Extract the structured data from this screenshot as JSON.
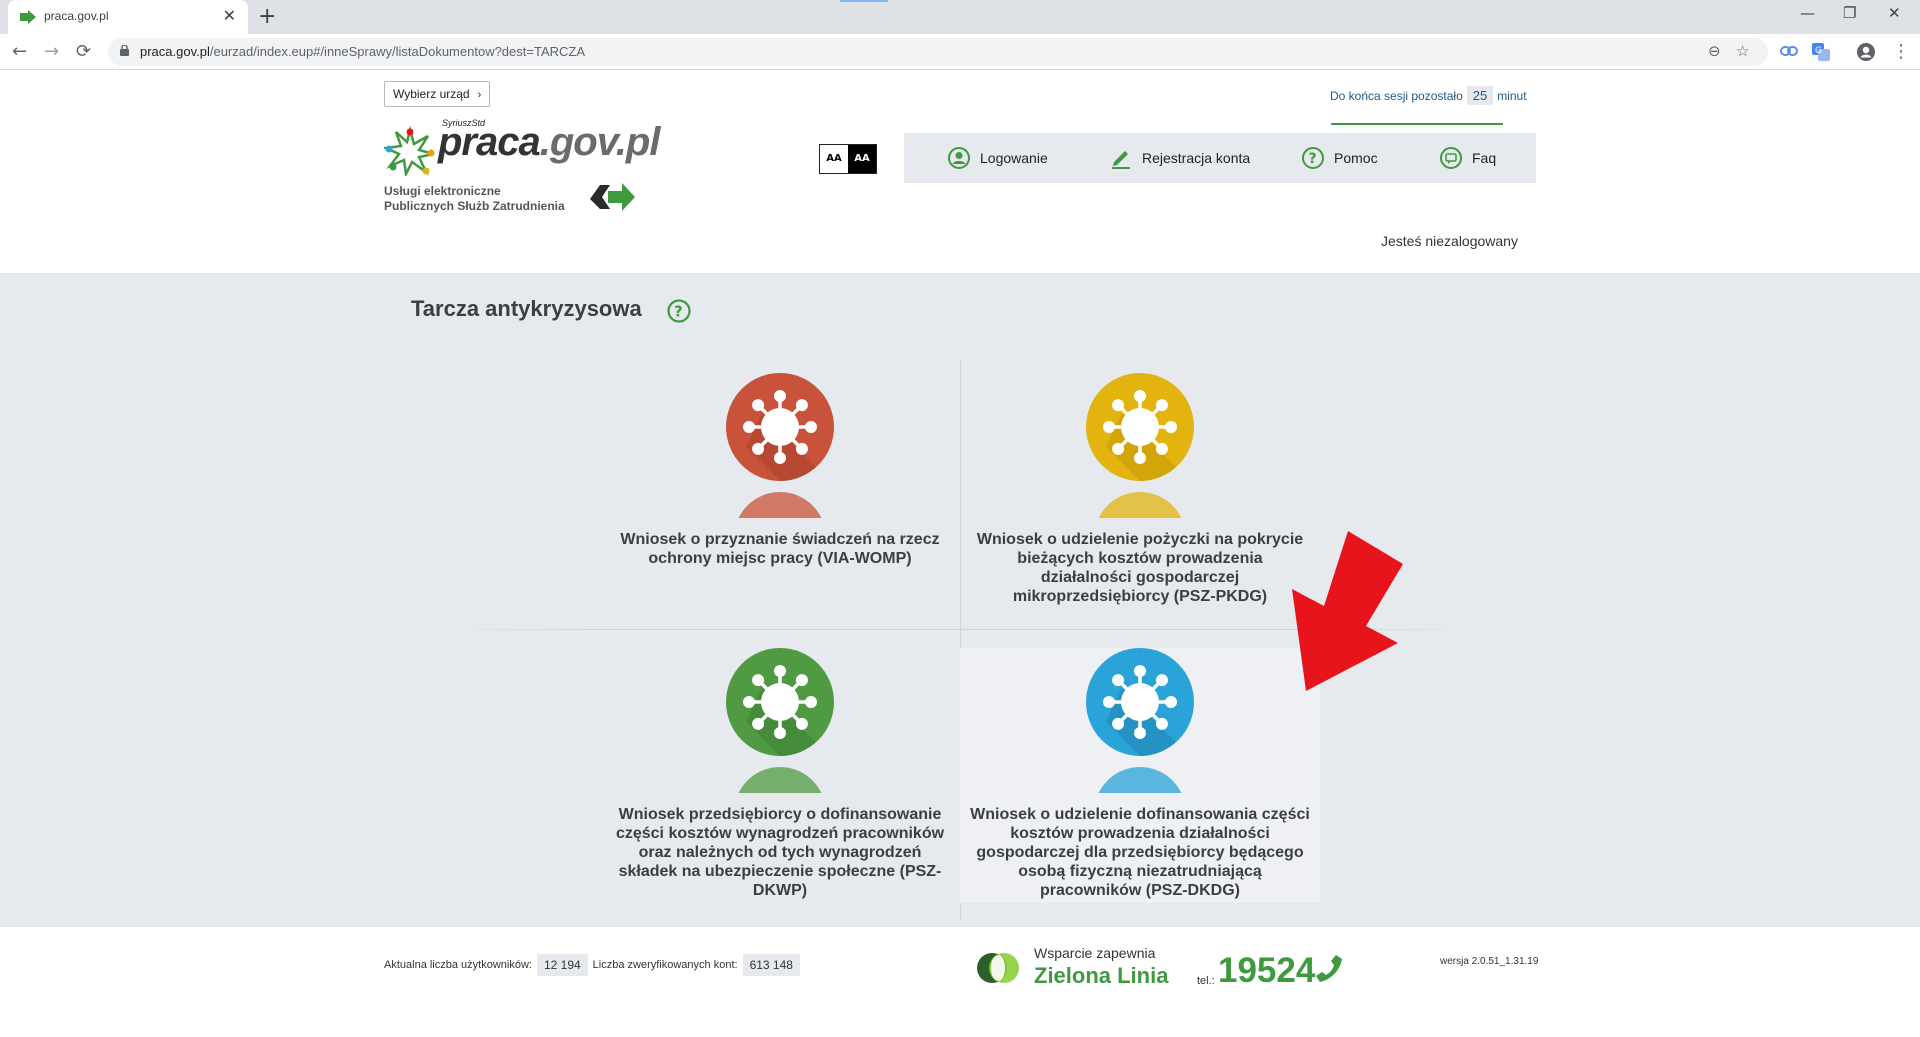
{
  "browser": {
    "tab_title": "praca.gov.pl",
    "tab_close": "✕",
    "new_tab": "+",
    "url_host": "praca.gov.pl",
    "url_path": "/eurzad/index.eup#/inneSprawy/listaDokumentow?dest=TARCZA",
    "back": "←",
    "forward": "→",
    "reload": "⟳",
    "win_min": "—",
    "win_max": "❐",
    "win_close": "✕",
    "zoom_icon": "⊖",
    "star_icon": "☆",
    "menu_icon": "⋮"
  },
  "header": {
    "choose_office": "Wybierz urząd",
    "chevron": "›",
    "logo_superscript": "SyriuszStd",
    "logo_brand_main": "praca",
    "logo_brand_gov": ".gov.pl",
    "logo_sub_line1": "Usługi elektroniczne",
    "logo_sub_line2": "Publicznych Służb Zatrudnienia",
    "session_prefix": "Do końca sesji pozostało",
    "session_minutes": "25",
    "session_suffix": "minut",
    "aa_normal": "AA",
    "aa_contrast": "AA",
    "nav": {
      "login": "Logowanie",
      "register": "Rejestracja konta",
      "help": "Pomoc",
      "faq": "Faq"
    },
    "not_logged": "Jesteś niezalogowany"
  },
  "main": {
    "title": "Tarcza antykryzysowa",
    "cards": [
      {
        "label": "Wniosek o przyznanie świadczeń na rzecz ochrony miejsc pracy (VIA-WOMP)",
        "color": "#c9533a",
        "color_dark": "#a8412c"
      },
      {
        "label": "Wniosek o udzielenie pożyczki na pokrycie bieżących kosztów prowadzenia działalności gospodarczej mikroprzedsiębiorcy (PSZ-PKDG)",
        "color": "#e3b40f",
        "color_dark": "#c49a06"
      },
      {
        "label": "Wniosek przedsiębiorcy o dofinansowanie części kosztów wynagrodzeń pracowników oraz należnych od tych wynagrodzeń składek na ubezpieczenie społeczne (PSZ-DKWP)",
        "color": "#4f9a42",
        "color_dark": "#3e7f33"
      },
      {
        "label": "Wniosek o udzielenie dofinansowania części kosztów prowadzenia działalności gospodarczej dla przedsiębiorcy będącego osobą fizyczną niezatrudniającą pracowników (PSZ-DKDG)",
        "color": "#2aa3d8",
        "color_dark": "#1f86b4"
      }
    ],
    "arrow_color": "#e8141c"
  },
  "footer": {
    "users_label": "Aktualna liczba użytkowników:",
    "users_value": "12 194",
    "verified_label": "Liczba zweryfikowanych kont:",
    "verified_value": "613 148",
    "support_line1": "Wsparcie zapewnia",
    "support_line2": "Zielona Linia",
    "tel_label": "tel.:",
    "tel_number": "19524",
    "version": "wersja 2.0.51_1.31.19"
  },
  "colors": {
    "green": "#3f9a3f",
    "nav_bg": "#e6e9ee",
    "main_bg": "#e6e9ee"
  }
}
